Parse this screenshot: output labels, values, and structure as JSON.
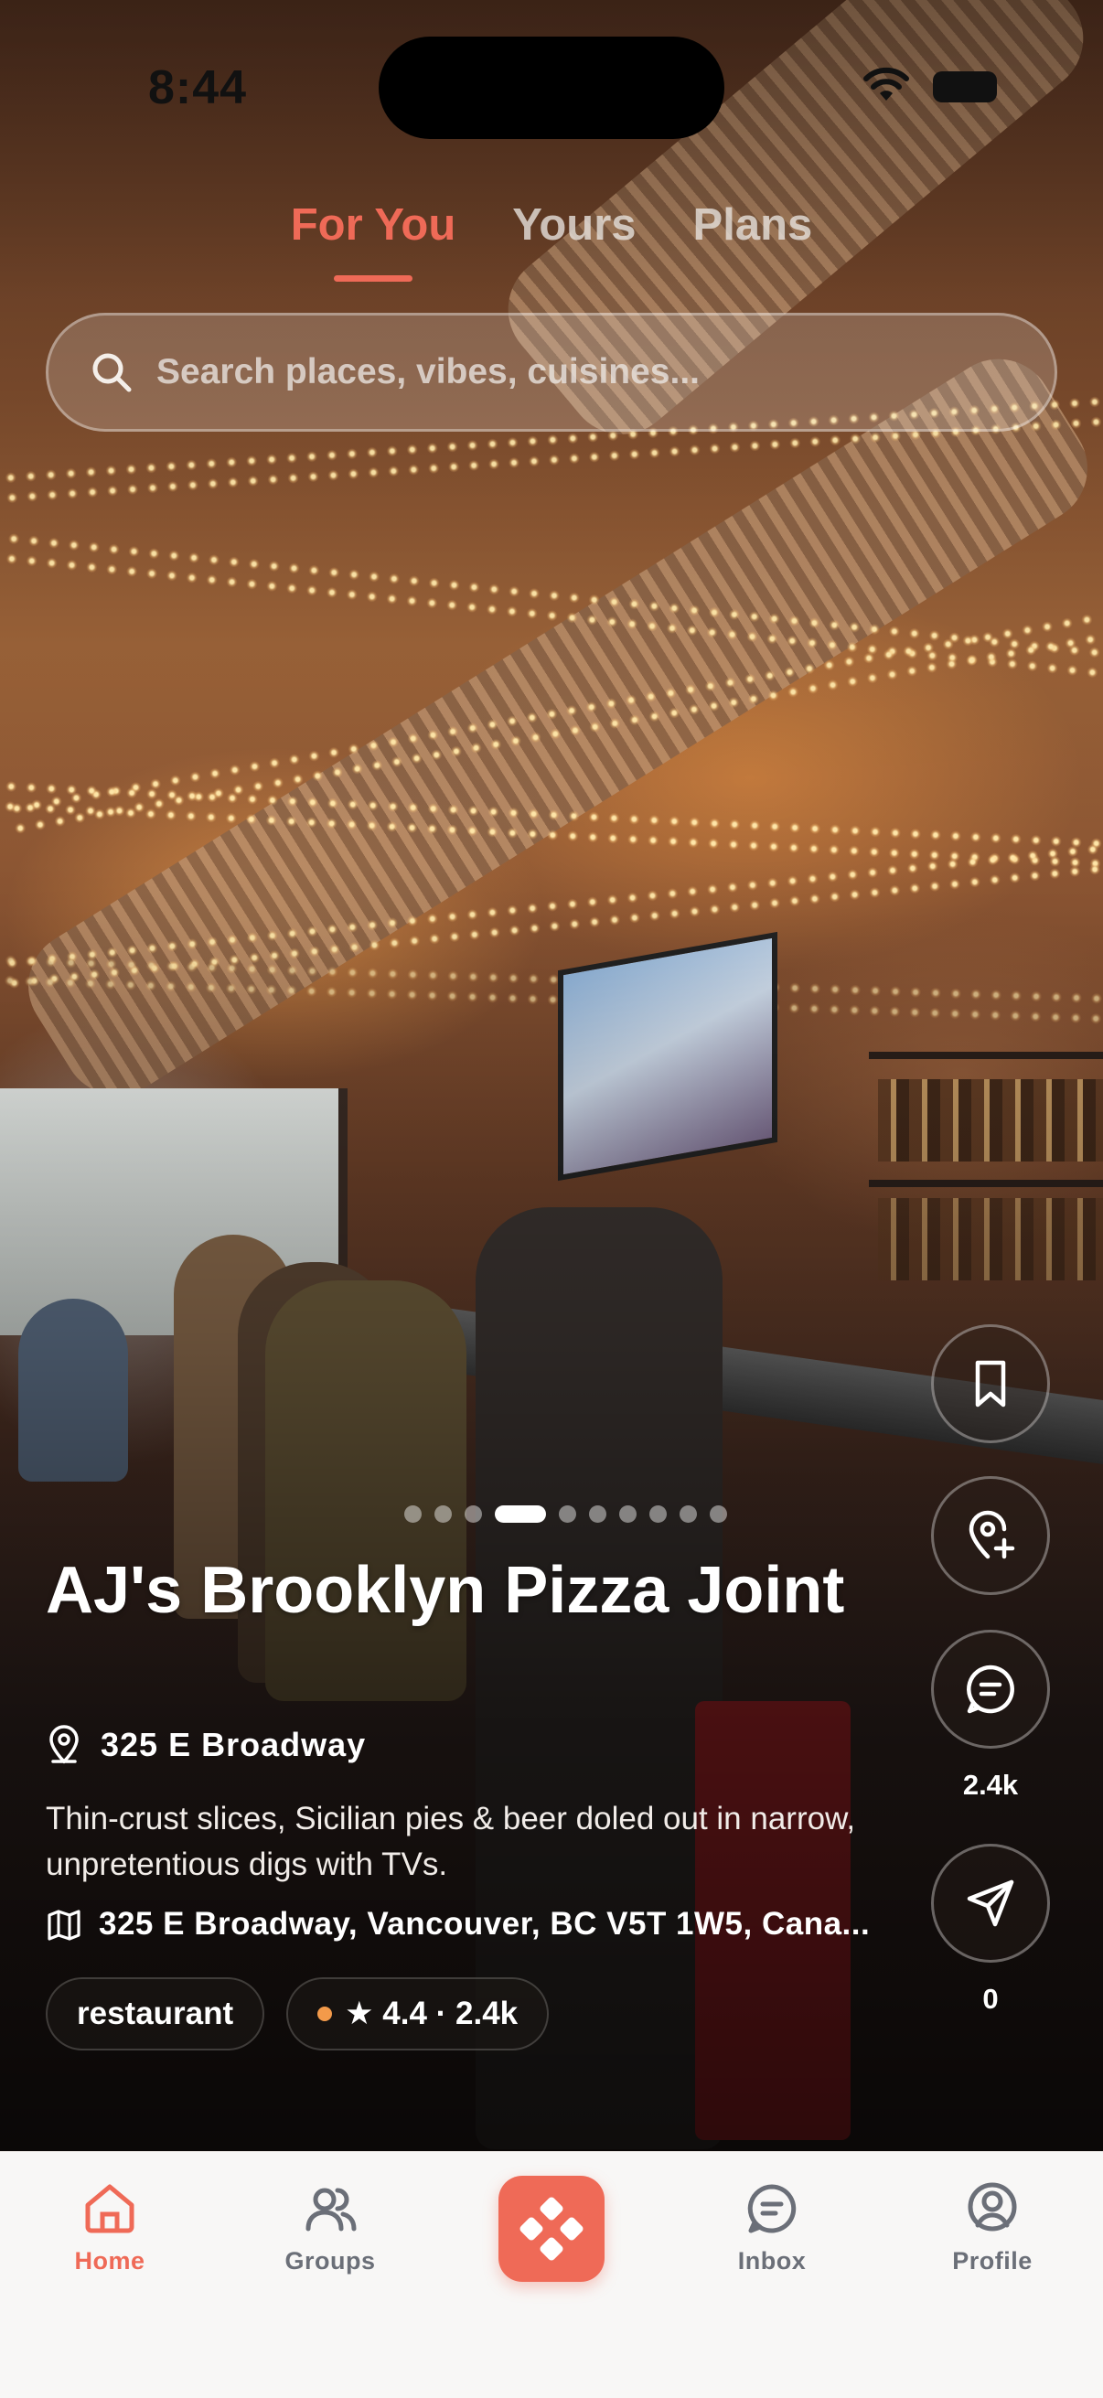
{
  "status_bar": {
    "time": "8:44"
  },
  "tabs": [
    {
      "label": "For You",
      "active": true
    },
    {
      "label": "Yours",
      "active": false
    },
    {
      "label": "Plans",
      "active": false
    }
  ],
  "search": {
    "placeholder": "Search places, vibes, cuisines..."
  },
  "carousel": {
    "total": 10,
    "active_index": 3
  },
  "place": {
    "name": "AJ's Brooklyn Pizza Joint",
    "short_address": "325 E Broadway",
    "description": "Thin-crust slices, Sicilian pies & beer doled out in narrow, unpretentious digs with TVs.",
    "full_address": "325 E Broadway, Vancouver, BC V5T 1W5, Cana...",
    "category": "restaurant",
    "rating": "★ 4.4 · 2.4k"
  },
  "actions": {
    "comments_count": "2.4k",
    "shares_count": "0"
  },
  "bottom_nav": {
    "items": [
      {
        "label": "Home",
        "icon": "home-icon",
        "active": true
      },
      {
        "label": "Groups",
        "icon": "groups-icon",
        "active": false
      },
      {
        "label": "Inbox",
        "icon": "inbox-icon",
        "active": false
      },
      {
        "label": "Profile",
        "icon": "profile-icon",
        "active": false
      }
    ]
  },
  "colors": {
    "accent": "#ef6a57",
    "status_dot": "#f39a4a",
    "nav_inactive": "#6b6f78",
    "nav_background": "#f8f7f6"
  }
}
